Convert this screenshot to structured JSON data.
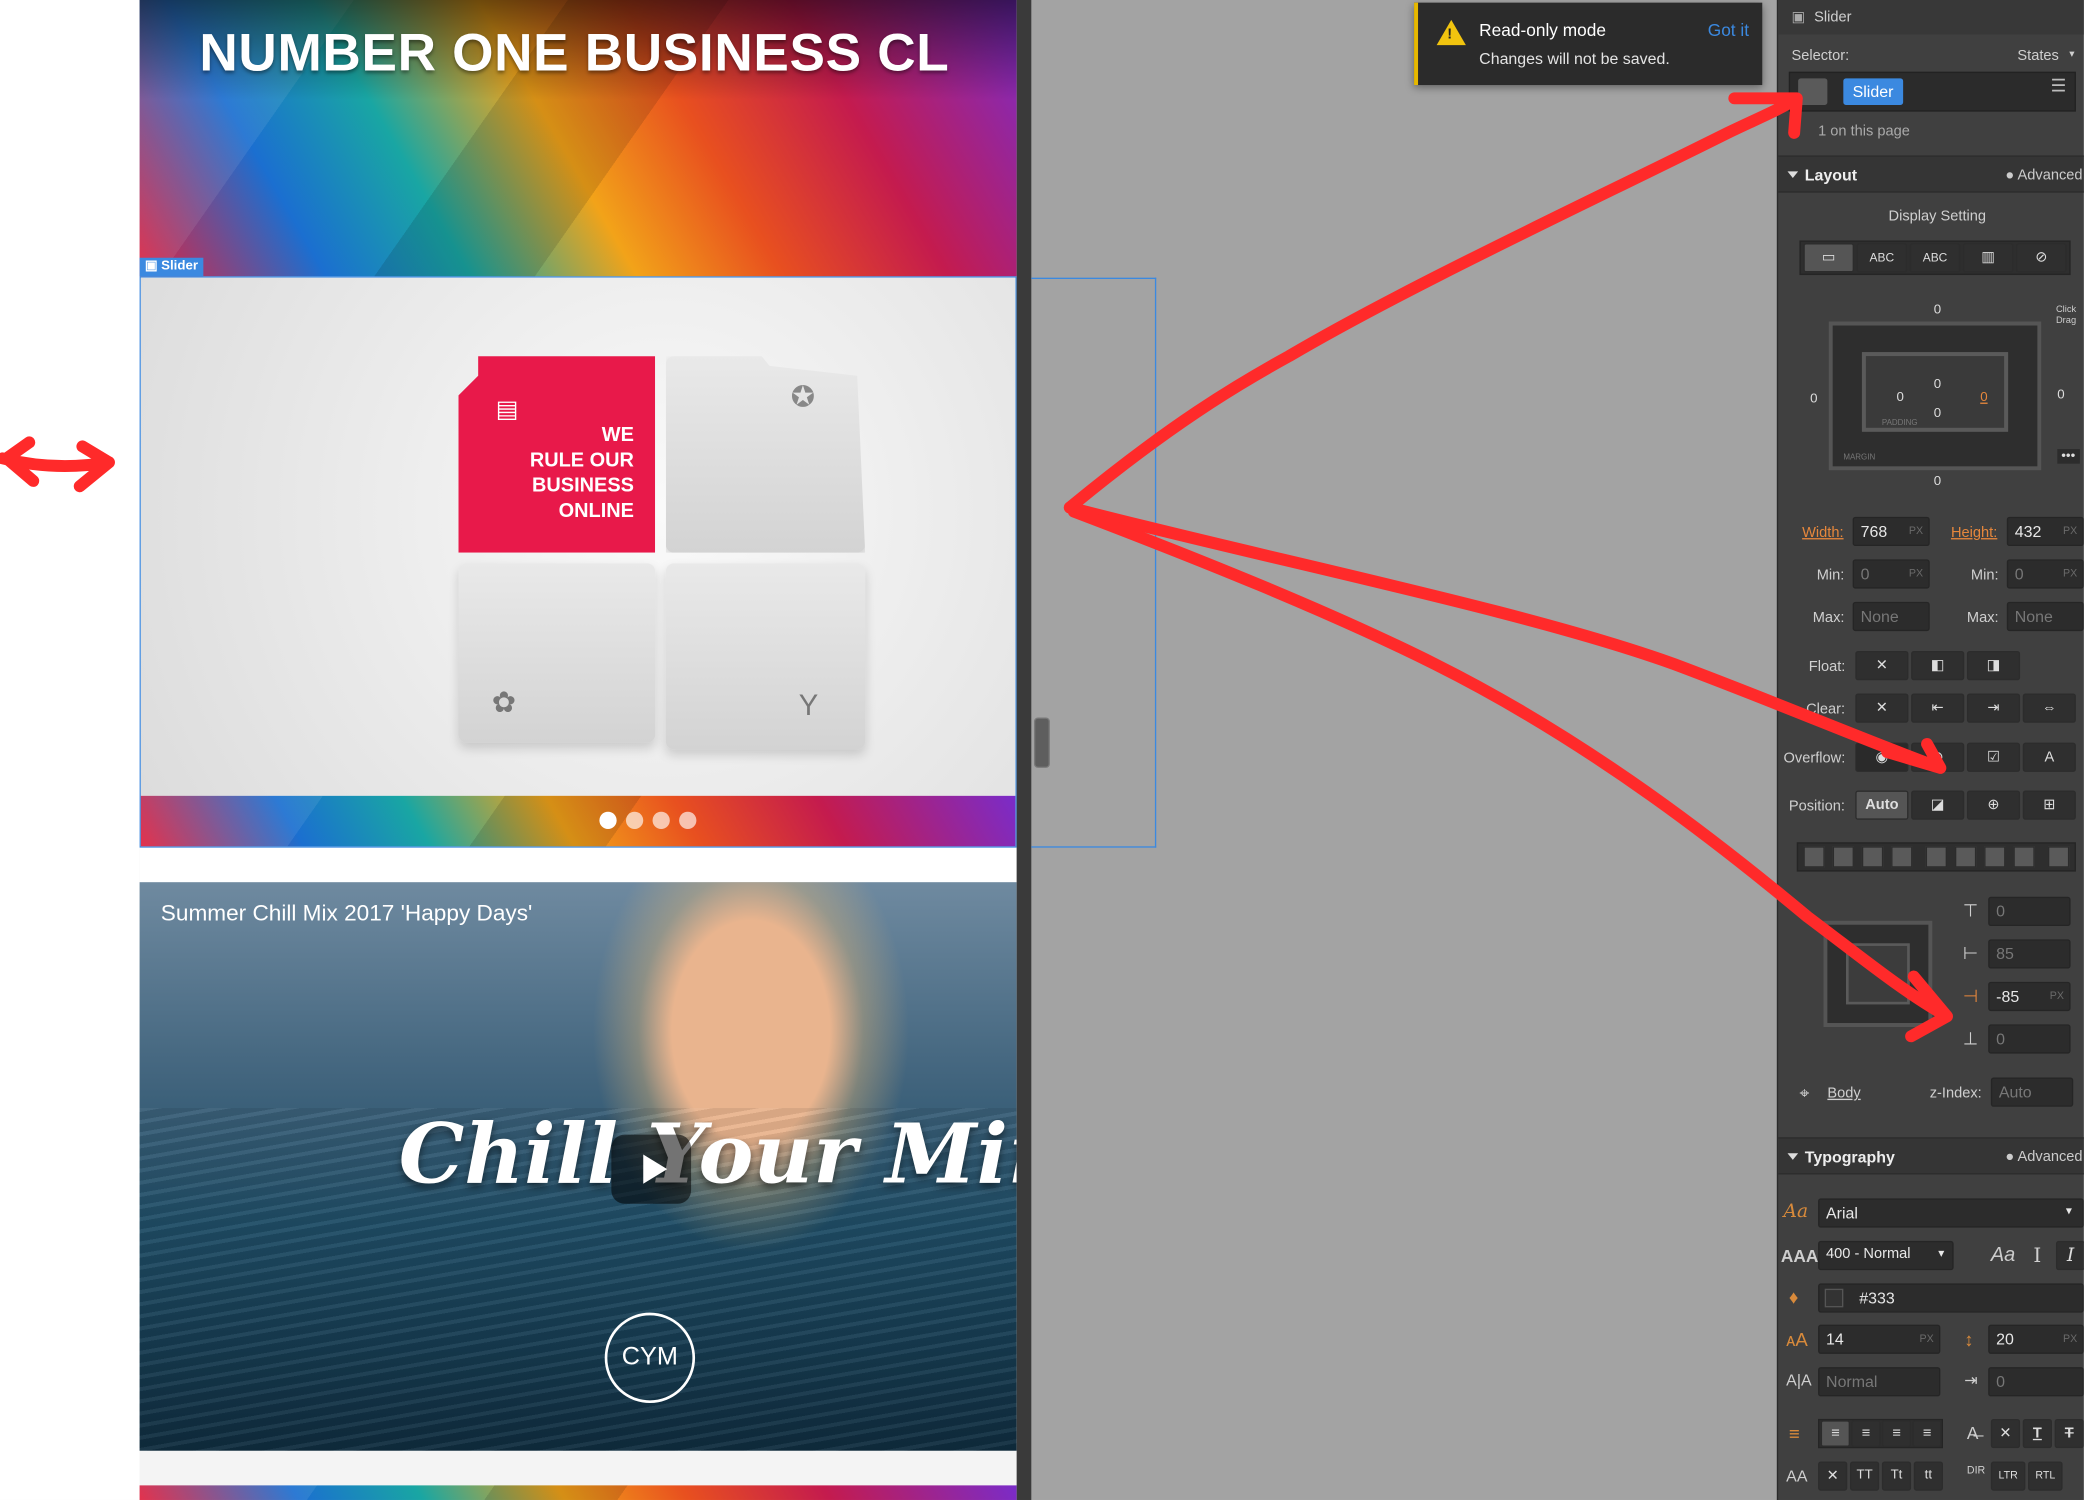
{
  "canvas": {
    "hero_title": "NUMBER ONE BUSINESS CL",
    "slider_tag": "Slider",
    "slide_text": "WE\nRULE OUR\nBUSINESS\nONLINE",
    "slider_dots": 4,
    "slider_active_dot": 1,
    "video_title": "Summer Chill Mix 2017 'Happy Days'",
    "video_script": "Chill Your Mind",
    "video_logo": "CYM"
  },
  "toast": {
    "title": "Read-only mode",
    "message": "Changes will not be saved.",
    "action": "Got it"
  },
  "panel": {
    "element_title": "Slider",
    "selector_label": "Selector:",
    "states_label": "States",
    "selector_chip": "Slider",
    "on_page": "1 on this page",
    "layout": {
      "header": "Layout",
      "advanced": "Advanced",
      "display_setting": "Display Setting",
      "display_options": [
        "",
        "ABC",
        "ABC",
        "",
        ""
      ],
      "box": {
        "margin_top": "0",
        "margin_left": "0",
        "margin_right": "0",
        "margin_bottom": "0",
        "pad_top": "0",
        "pad_left": "0",
        "pad_right": "0",
        "pad_bottom": "0",
        "padding_label": "PADDING",
        "margin_label": "MARGIN",
        "click_drag": "Click\nDrag"
      },
      "width_label": "Width:",
      "width": "768",
      "height_label": "Height:",
      "height": "432",
      "unit": "PX",
      "min_label": "Min:",
      "min_w": "0",
      "min_h": "0",
      "max_label": "Max:",
      "max_w": "None",
      "max_h": "None",
      "float_label": "Float:",
      "clear_label": "Clear:",
      "overflow_label": "Overflow:",
      "position_label": "Position:",
      "position_auto": "Auto",
      "pos_top": "0",
      "pos_left": "85",
      "pos_right": "-85",
      "pos_bottom": "0",
      "relative_to": "Body",
      "zindex_label": "z-Index:",
      "zindex": "Auto"
    },
    "typography": {
      "header": "Typography",
      "advanced": "Advanced",
      "font": "Arial",
      "weight": "400 - Normal",
      "color": "#333",
      "size": "14",
      "line_height": "20",
      "letter_spacing": "Normal",
      "text_indent": "0",
      "case_buttons": [
        "TT",
        "Tt",
        "tt"
      ],
      "dir_buttons": [
        "LTR",
        "RTL"
      ]
    }
  },
  "colors": {
    "accent": "#3b89e0",
    "brand_red": "#e8194a",
    "annotation": "#ff2a2a",
    "warning": "#f1c40f",
    "orange_label": "#e6873c"
  }
}
